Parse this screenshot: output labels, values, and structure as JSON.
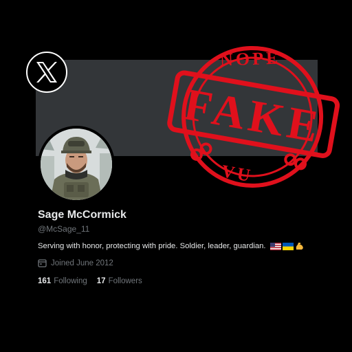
{
  "profile": {
    "display_name": "Sage McCormick",
    "handle": "@McSage_11",
    "bio": "Serving with honor, protecting with pride. Soldier, leader, guardian.",
    "bio_emoji": [
      "us-flag",
      "ukraine-flag",
      "flexed-biceps"
    ],
    "joined": "Joined June 2012",
    "following_count": "161",
    "following_label": "Following",
    "followers_count": "17",
    "followers_label": "Followers"
  },
  "stamp": {
    "top_text": "NOPE",
    "main_text": "FAKE",
    "bottom_text": "VU",
    "color": "#e0101c"
  },
  "colors": {
    "background": "#000000",
    "banner": "#333639",
    "primary_text": "#e7e9ea",
    "secondary_text": "#71767b"
  },
  "icons": [
    "x-logo-icon",
    "calendar-icon",
    "binoculars-icon"
  ]
}
